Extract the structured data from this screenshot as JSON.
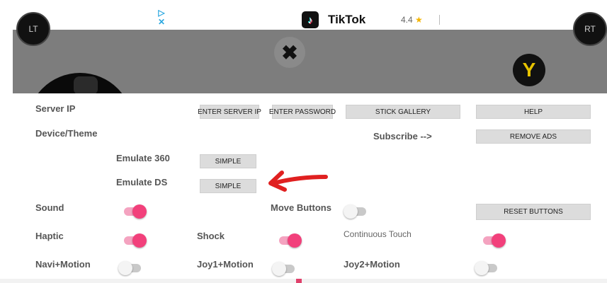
{
  "ad": {
    "app_name": "TikTok",
    "rating": "4.4",
    "rating_star": "★",
    "choice_glyph": "▷",
    "close_glyph": "✕"
  },
  "gamepad": {
    "lt_label": "LT",
    "rt_label": "RT",
    "x_label": "✖",
    "y_label": "Y"
  },
  "settings": {
    "server_ip_label": "Server IP",
    "device_theme_label": "Device/Theme",
    "emulate_360_label": "Emulate 360",
    "emulate_ds_label": "Emulate DS",
    "sound_label": "Sound",
    "haptic_label": "Haptic",
    "navi_motion_label": "Navi+Motion",
    "move_buttons_label": "Move Buttons",
    "shock_label": "Shock",
    "joy1_motion_label": "Joy1+Motion",
    "continuous_touch_label": "Continuous Touch",
    "joy2_motion_label": "Joy2+Motion",
    "subscribe_label": "Subscribe -->",
    "buttons": {
      "enter_server_ip": "ENTER SERVER IP",
      "enter_password": "ENTER PASSWORD",
      "stick_gallery": "STICK GALLERY",
      "help": "HELP",
      "remove_ads": "REMOVE ADS",
      "emulate_360_mode": "SIMPLE",
      "emulate_ds_mode": "SIMPLE",
      "reset_buttons": "RESET BUTTONS"
    },
    "toggles": {
      "sound": true,
      "haptic": true,
      "navi_motion": false,
      "move_buttons": false,
      "shock": true,
      "joy1_motion": false,
      "continuous_touch": true,
      "joy2_motion": false
    }
  },
  "colors": {
    "toggle_on": "#f2407b",
    "annotation_arrow": "#e02020"
  }
}
